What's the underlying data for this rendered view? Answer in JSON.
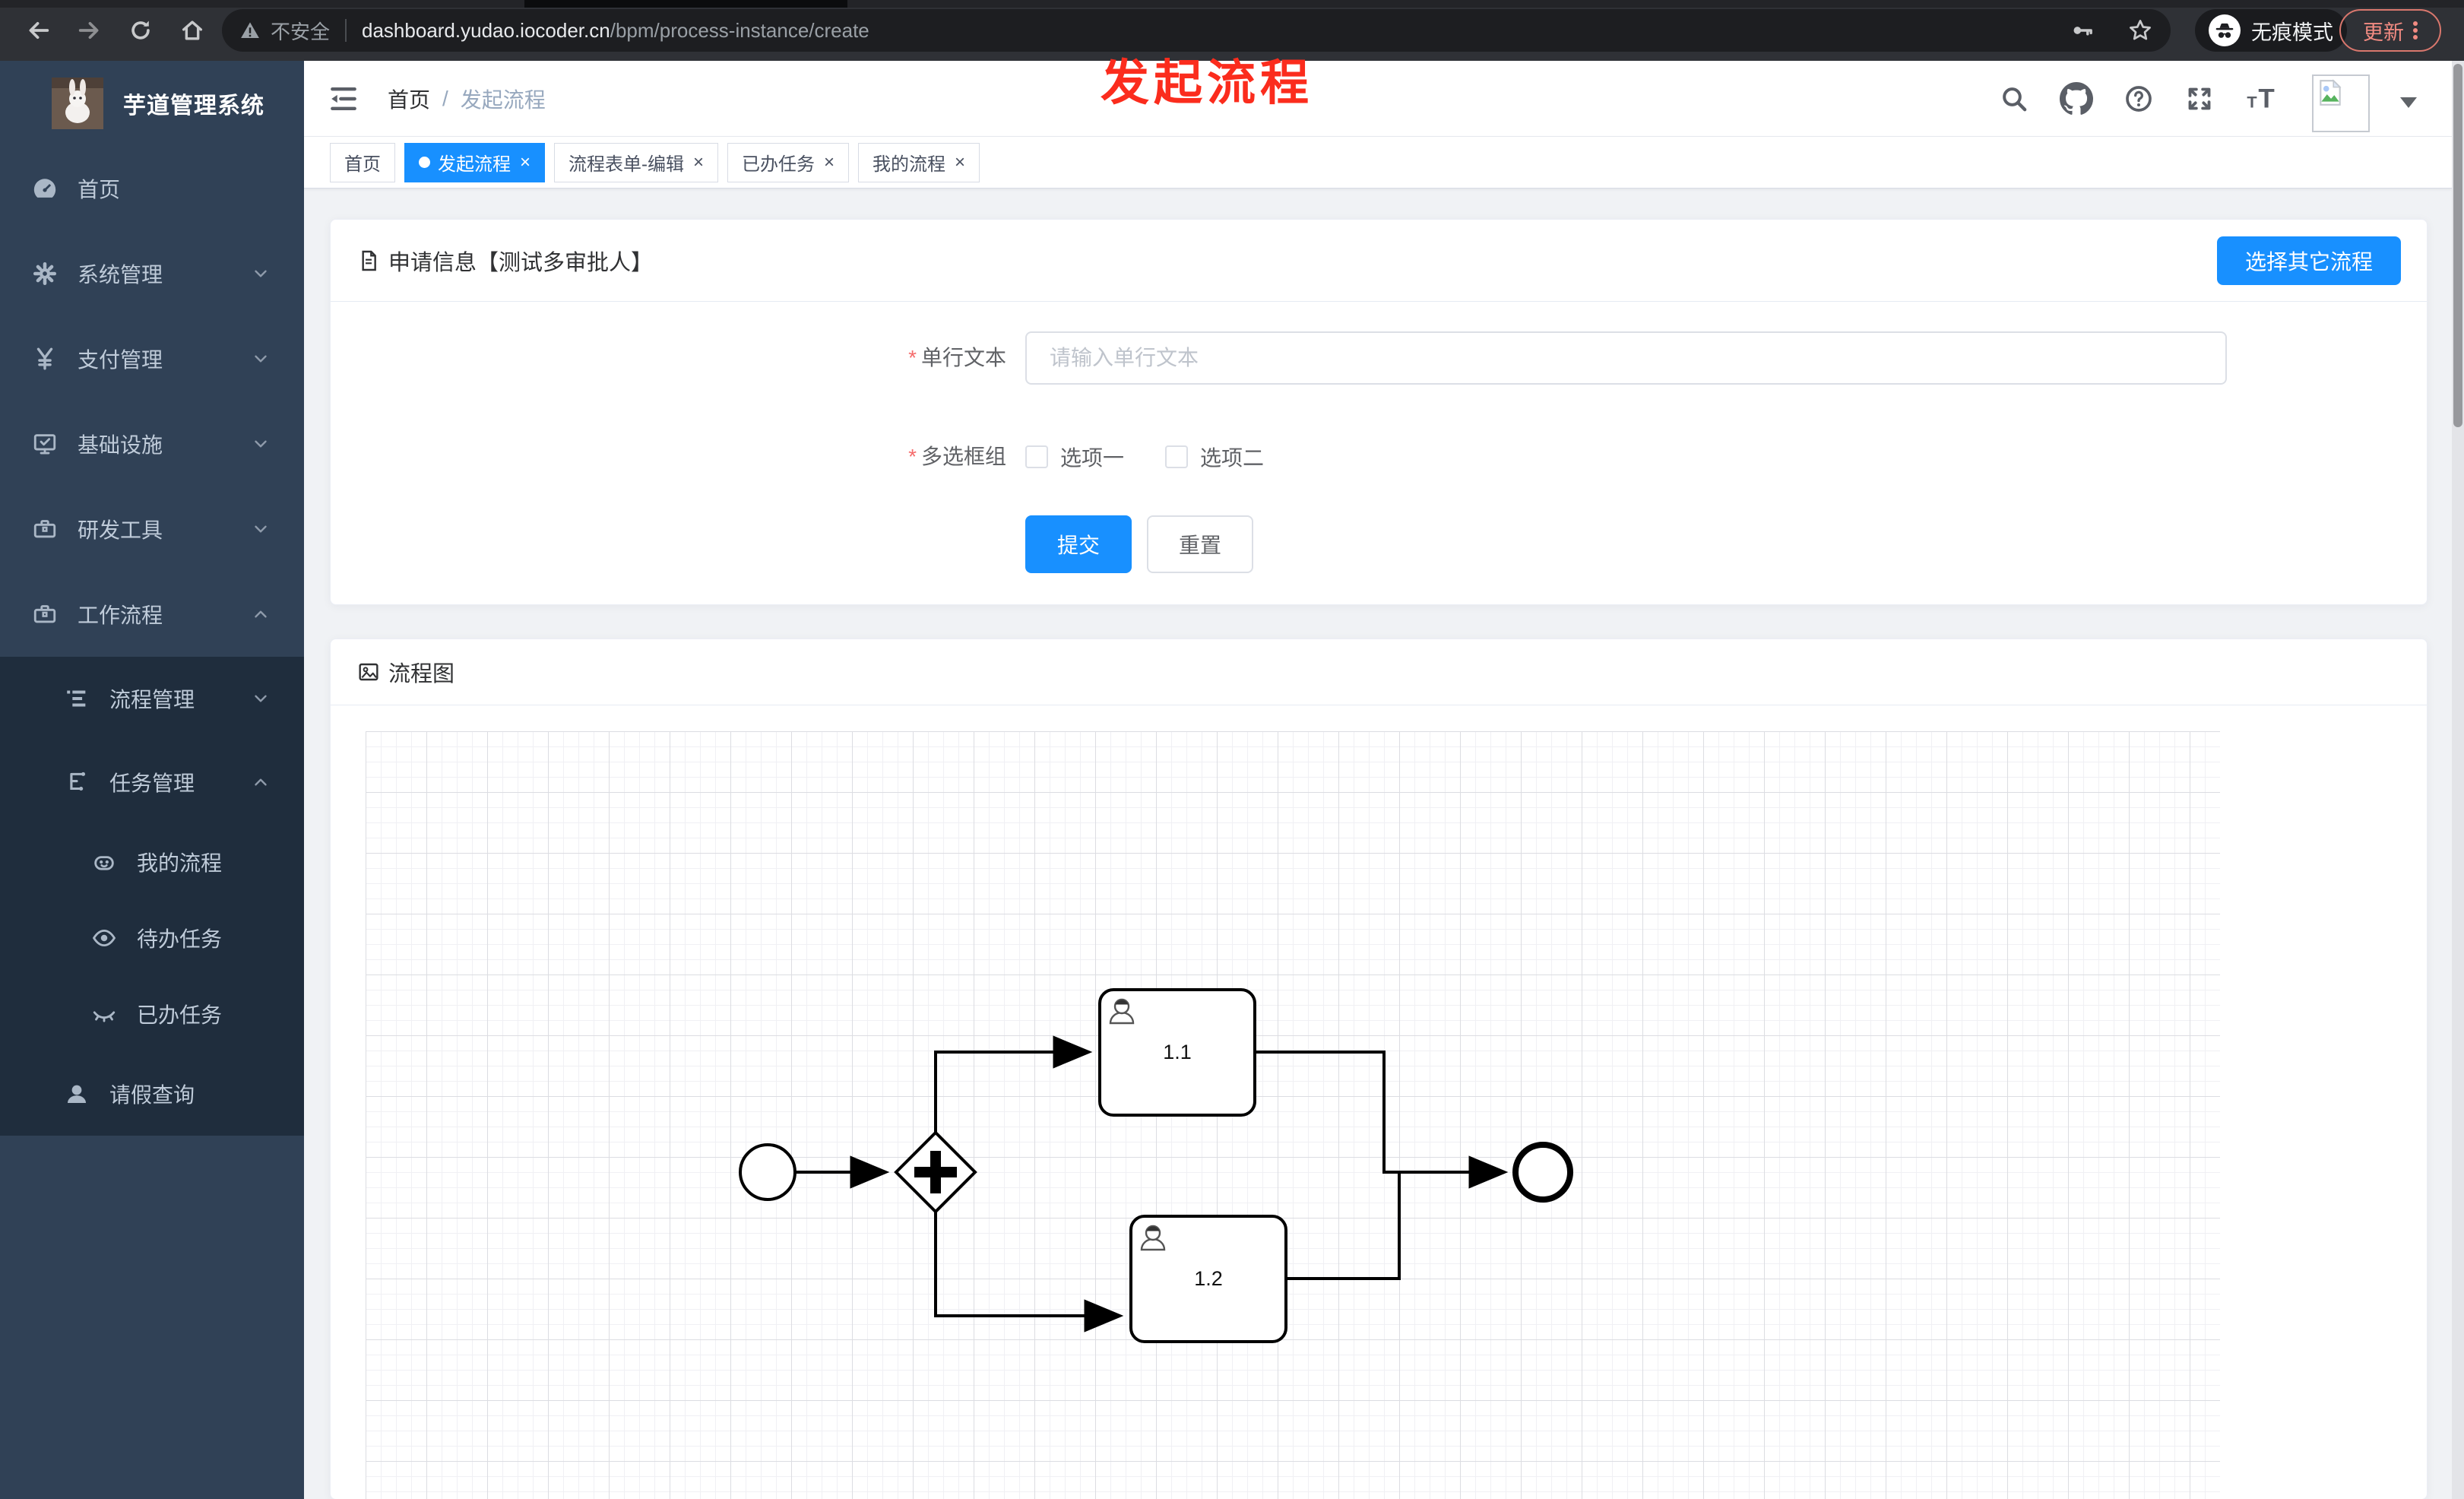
{
  "colors": {
    "accent": "#1890ff",
    "sidebar_bg": "#304156",
    "submenu_bg": "#1f2d3d",
    "content_bg": "#f0f2f5",
    "annotation_red": "#fb2c1d",
    "update_red": "#f28b82"
  },
  "annotation": {
    "text": "发起流程"
  },
  "browser": {
    "security_label": "不安全",
    "url_host": "dashboard.yudao.iocoder.cn",
    "url_path": "/bpm/process-instance/create",
    "incognito_label": "无痕模式",
    "update_label": "更新"
  },
  "sidebar": {
    "title": "芋道管理系统",
    "items": [
      {
        "label": "首页",
        "icon": "dashboard-icon"
      },
      {
        "label": "系统管理",
        "icon": "gear-icon"
      },
      {
        "label": "支付管理",
        "icon": "yen-icon"
      },
      {
        "label": "基础设施",
        "icon": "monitor-icon"
      },
      {
        "label": "研发工具",
        "icon": "toolbox-icon"
      },
      {
        "label": "工作流程",
        "icon": "briefcase-icon"
      },
      {
        "label": "流程管理",
        "icon": "list-tree-icon"
      },
      {
        "label": "任务管理",
        "icon": "flow-branch-icon"
      },
      {
        "label": "我的流程",
        "icon": "robot-icon"
      },
      {
        "label": "待办任务",
        "icon": "eye-open-icon"
      },
      {
        "label": "已办任务",
        "icon": "eye-closed-icon"
      },
      {
        "label": "请假查询",
        "icon": "user-icon"
      }
    ]
  },
  "header": {
    "breadcrumb": [
      "首页",
      "发起流程"
    ]
  },
  "ui": {
    "breadcrumb_separator": "/",
    "close_glyph": "×"
  },
  "tabs": [
    {
      "label": "首页",
      "active": false,
      "closable": false
    },
    {
      "label": "发起流程",
      "active": true,
      "closable": true
    },
    {
      "label": "流程表单-编辑",
      "active": false,
      "closable": true
    },
    {
      "label": "已办任务",
      "active": false,
      "closable": true
    },
    {
      "label": "我的流程",
      "active": false,
      "closable": true
    }
  ],
  "form_card": {
    "title": "申请信息【测试多审批人】",
    "choose_other_button": "选择其它流程",
    "single_line": {
      "label": "单行文本",
      "required": true,
      "value": "",
      "placeholder": "请输入单行文本"
    },
    "checkbox_group": {
      "label": "多选框组",
      "required": true,
      "options": [
        {
          "label": "选项一",
          "checked": false
        },
        {
          "label": "选项二",
          "checked": false
        }
      ]
    },
    "submit_label": "提交",
    "reset_label": "重置"
  },
  "flow_card": {
    "title": "流程图",
    "diagram": {
      "type": "bpmn",
      "start_event": "start",
      "gateway": "parallel-gateway",
      "tasks": [
        {
          "label": "1.1"
        },
        {
          "label": "1.2"
        }
      ],
      "end_event": "end"
    }
  }
}
